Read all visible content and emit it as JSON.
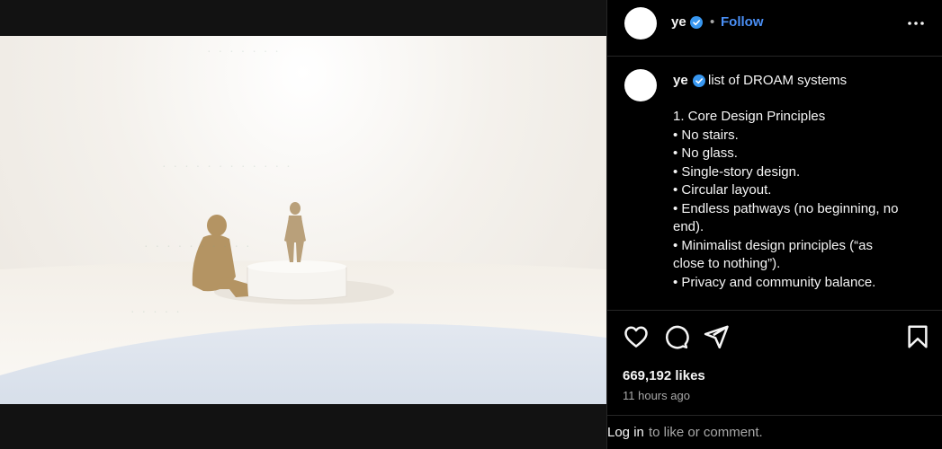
{
  "header": {
    "username": "ye",
    "separator": "•",
    "follow_label": "Follow",
    "more_icon": "more-horizontal-icon"
  },
  "caption": {
    "username": "ye",
    "title": "list of DROAM systems",
    "lines": [
      "1. Core Design Principles",
      "• No stairs.",
      "• No glass.",
      "• Single-story design.",
      "• Circular layout.",
      "• Endless pathways (no beginning, no",
      "end).",
      "• Minimalist design principles (“as",
      "close to nothing”).",
      "• Privacy and community balance."
    ]
  },
  "actions": {
    "like_icon": "heart-icon",
    "comment_icon": "comment-icon",
    "share_icon": "share-icon",
    "save_icon": "bookmark-icon"
  },
  "likes": "669,192 likes",
  "timestamp": "11 hours ago",
  "footer": {
    "login_label": "Log in",
    "rest": "to like or comment."
  },
  "colors": {
    "background": "#000000",
    "accent": "#4a8ff5",
    "verified": "#3897f0",
    "muted_text": "#a8a8a8",
    "divider": "#262626"
  }
}
